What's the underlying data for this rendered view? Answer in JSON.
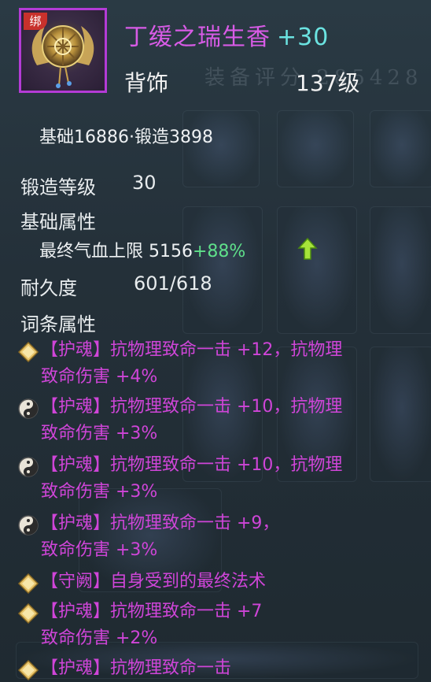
{
  "item": {
    "bound_badge": "绑",
    "name": "丁缓之瑞生香",
    "enhance": "+30",
    "slot": "背饰",
    "level": "137级"
  },
  "stats": {
    "base_forge": "基础16886·锻造3898",
    "forge_level_label": "锻造等级",
    "forge_level_value": "30",
    "base_attr_heading": "基础属性",
    "base_attr_line": "最终气血上限 5156",
    "base_attr_bonus": "+88%",
    "durability_label": "耐久度",
    "durability_value": "601/618",
    "affix_heading": "词条属性"
  },
  "affixes": [
    {
      "icon": "gold-diamond-icon",
      "line1": "【护魂】抗物理致命一击 +12，抗物理",
      "line2": "致命伤害 +4%"
    },
    {
      "icon": "taiji-icon",
      "line1": "【护魂】抗物理致命一击 +10，抗物理",
      "line2": "致命伤害 +3%"
    },
    {
      "icon": "taiji-icon",
      "line1": "【护魂】抗物理致命一击 +10，抗物理",
      "line2": "致命伤害 +3%"
    },
    {
      "icon": "taiji-icon",
      "line1": "【护魂】抗物理致命一击 +9，",
      "line2": "致命伤害 +3%"
    },
    {
      "icon": "gold-diamond-icon",
      "line1": "【守阙】自身受到的最终法术",
      "line2": ""
    },
    {
      "icon": "gold-diamond-icon",
      "line1": "【护魂】抗物理致命一击 +7",
      "line2": "致命伤害 +2%"
    },
    {
      "icon": "gold-diamond-icon",
      "line1": "【护魂】抗物理致命一击",
      "line2": ""
    }
  ],
  "background": {
    "watermark": "装备评分 285428"
  },
  "colors": {
    "title_purple": "#d85be6",
    "enhance_cyan": "#6be3e1",
    "affix_magenta": "#cf45d8",
    "bonus_green": "#5fe08a",
    "rarity_border": "#b43bd6"
  }
}
